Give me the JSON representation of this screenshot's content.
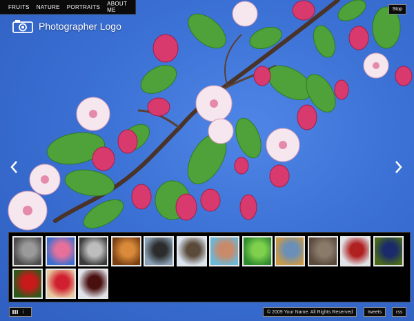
{
  "nav": {
    "items": [
      {
        "label": "FRUITS"
      },
      {
        "label": "NATURE"
      },
      {
        "label": "PORTRAITS"
      },
      {
        "label": "ABOUT ME"
      }
    ]
  },
  "controls": {
    "stop_label": "Stop"
  },
  "logo": {
    "text": "Photographer Logo"
  },
  "thumbnails": [
    {
      "name": "thumb-bw-child",
      "colors": [
        "#4a4a4a",
        "#9a9a9a"
      ]
    },
    {
      "name": "thumb-blossom",
      "colors": [
        "#3a6fd0",
        "#e6709a"
      ]
    },
    {
      "name": "thumb-bw-man",
      "colors": [
        "#3a3a3a",
        "#bdbdbd"
      ]
    },
    {
      "name": "thumb-dog",
      "colors": [
        "#7a3f12",
        "#d98a3a"
      ]
    },
    {
      "name": "thumb-cow",
      "colors": [
        "#8aa2b8",
        "#2c2c2c"
      ]
    },
    {
      "name": "thumb-eagle",
      "colors": [
        "#d9e4f0",
        "#5a4a3a"
      ]
    },
    {
      "name": "thumb-woman",
      "colors": [
        "#6bb8d9",
        "#c98a6a"
      ]
    },
    {
      "name": "thumb-leaf",
      "colors": [
        "#2e8b2e",
        "#7fd14d"
      ]
    },
    {
      "name": "thumb-autumn",
      "colors": [
        "#c89a4a",
        "#6a8fb8"
      ]
    },
    {
      "name": "thumb-bark",
      "colors": [
        "#5a4a3e",
        "#8a7a6a"
      ]
    },
    {
      "name": "thumb-berries",
      "colors": [
        "#dfe4e8",
        "#b02020"
      ]
    },
    {
      "name": "thumb-blue-berries",
      "colors": [
        "#4a6a1a",
        "#1a2a6a"
      ]
    },
    {
      "name": "thumb-red-berries",
      "colors": [
        "#2a5a1a",
        "#c81a1a"
      ]
    },
    {
      "name": "thumb-tart",
      "colors": [
        "#e8c8a0",
        "#d02030"
      ]
    },
    {
      "name": "thumb-cherries",
      "colors": [
        "#dfe4ea",
        "#4a1010"
      ]
    }
  ],
  "footer": {
    "copyright": "© 2009 Your Name. All Rights Reserved",
    "tweets_label": "tweets",
    "rss_label": "rss",
    "info_label": "i"
  },
  "colors": {
    "sky": "#3a6fd0",
    "chrome": "#0b0b0b",
    "blossom": "#e0507e"
  }
}
